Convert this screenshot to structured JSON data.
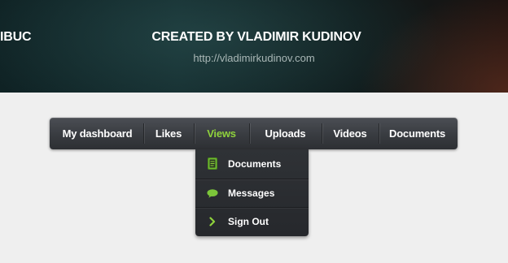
{
  "hero": {
    "left_text": "IBUC",
    "title": "CREATED BY VLADIMIR KUDINOV",
    "link": "http://vladimirkudinov.com"
  },
  "menu": {
    "items": [
      {
        "label": "My dashboard",
        "active": false
      },
      {
        "label": "Likes",
        "active": false
      },
      {
        "label": "Views",
        "active": true
      },
      {
        "label": "Uploads",
        "active": false
      },
      {
        "label": "Videos",
        "active": false
      },
      {
        "label": "Documents",
        "active": false
      }
    ]
  },
  "dropdown": {
    "items": [
      {
        "label": "Documents",
        "icon": "document-icon"
      },
      {
        "label": "Messages",
        "icon": "speech-bubble-icon"
      },
      {
        "label": "Sign Out",
        "icon": "chevron-right-icon"
      }
    ]
  },
  "colors": {
    "accent": "#8fd23c",
    "menu_bg": "#3a3d42",
    "page_bg": "#efefef"
  }
}
